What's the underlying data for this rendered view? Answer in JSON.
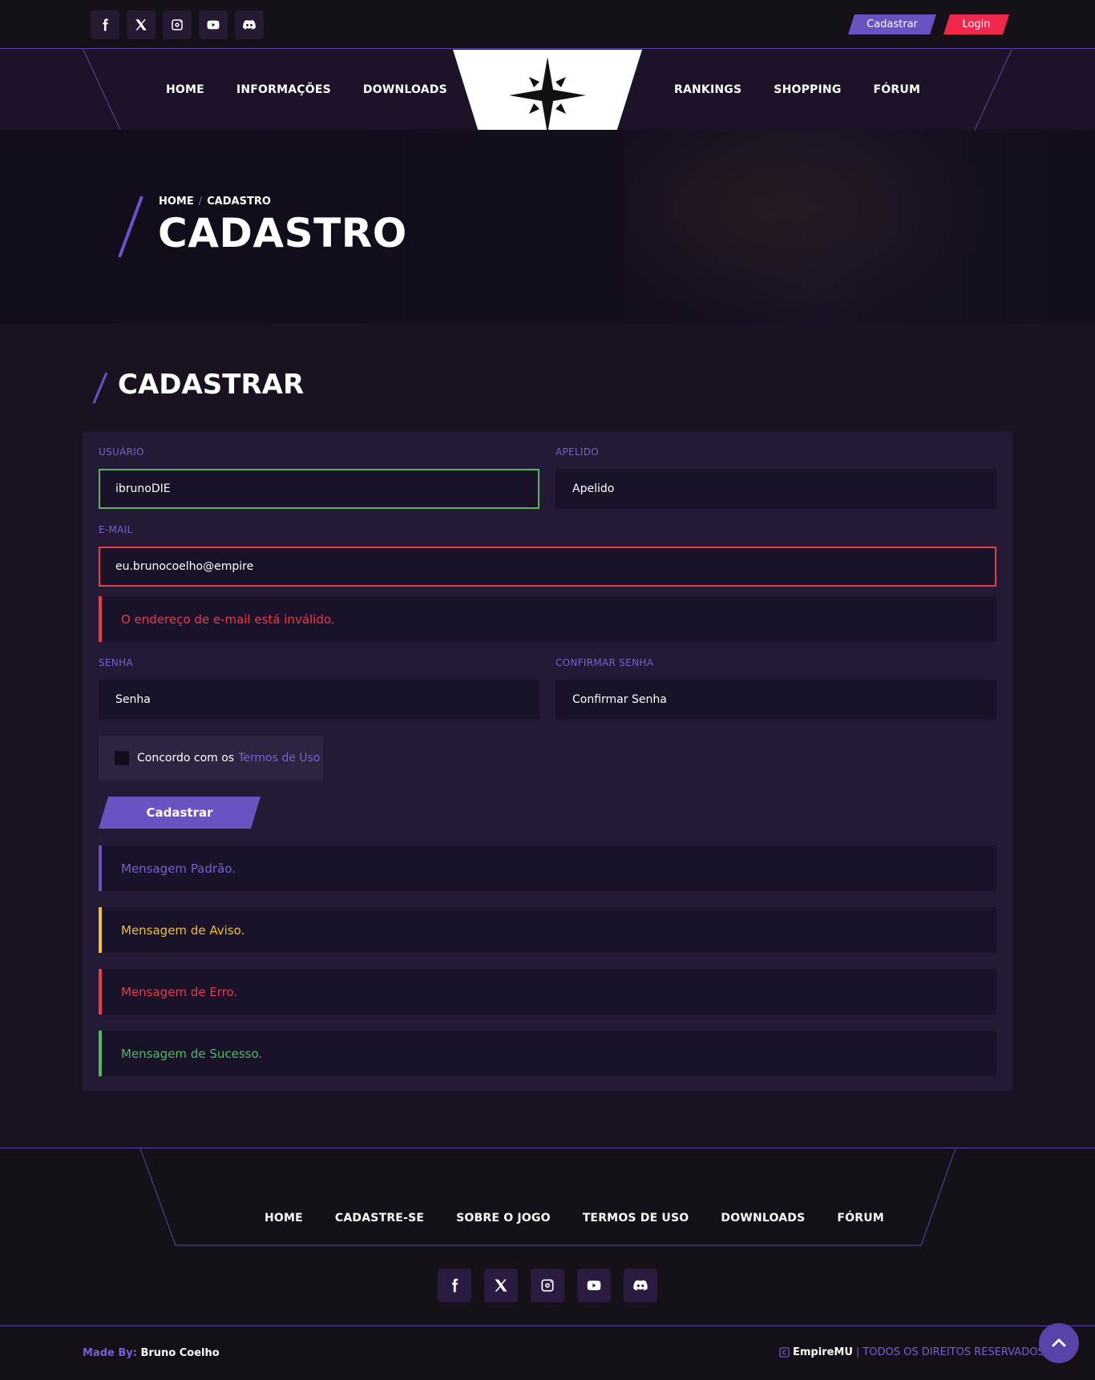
{
  "topbar": {
    "social": [
      "facebook-icon",
      "x-icon",
      "instagram-icon",
      "youtube-icon",
      "discord-icon"
    ],
    "register_label": "Cadastrar",
    "login_label": "Login"
  },
  "nav": {
    "left": [
      "HOME",
      "INFORMAÇÕES",
      "DOWNLOADS"
    ],
    "right": [
      "RANKINGS",
      "SHOPPING",
      "FÓRUM"
    ],
    "logo_icon": "compass-star-icon"
  },
  "hero": {
    "crumb_home": "HOME",
    "crumb_sep": "/",
    "crumb_current": "CADASTRO",
    "title": "CADASTRO"
  },
  "section": {
    "title": "CADASTRAR"
  },
  "form": {
    "user_label": "USUÁRIO",
    "user_value": "ibrunoDIE",
    "nick_label": "APELIDO",
    "nick_placeholder": "Apelido",
    "email_label": "E-MAIL",
    "email_value": "eu.brunocoelho@empire",
    "email_error": "O endereço de e-mail está inválido.",
    "pass_label": "SENHA",
    "pass_placeholder": "Senha",
    "confirm_label": "CONFIRMAR SENHA",
    "confirm_placeholder": "Confirmar Senha",
    "terms_text": "Concordo com os",
    "terms_link": "Termos de Uso",
    "submit_label": "Cadastrar"
  },
  "messages": {
    "default": "Mensagem Padrão.",
    "warning": "Mensagem de Aviso.",
    "error": "Mensagem de Erro.",
    "success": "Mensagem de Sucesso."
  },
  "colors": {
    "accent": "#6b52c3",
    "login": "#f0294c",
    "error": "#ea3a4d",
    "warning": "#f0c12b",
    "success": "#4dbb62",
    "background": "#1a1220"
  },
  "footer": {
    "nav": [
      "HOME",
      "CADASTRE-SE",
      "SOBRE O JOGO",
      "TERMOS DE USO",
      "DOWNLOADS",
      "FÓRUM"
    ],
    "made_prefix": "Made By:",
    "made_name": "Bruno Coelho",
    "brand": "EmpireMU",
    "divider": "|",
    "rights": "TODOS OS DIREITOS RESERVADOS"
  }
}
